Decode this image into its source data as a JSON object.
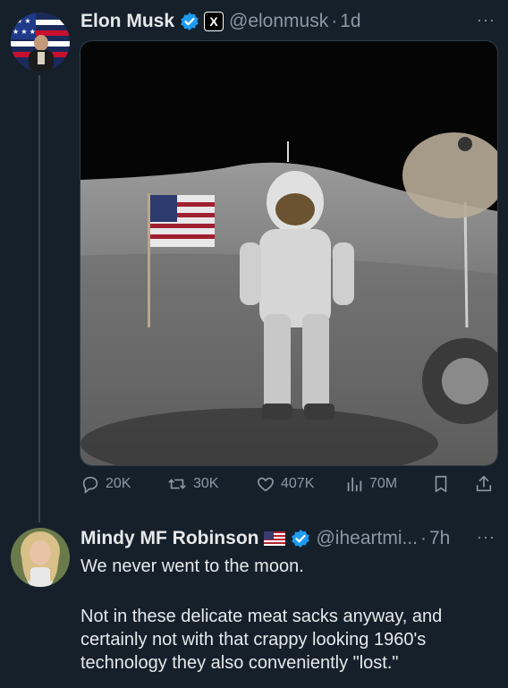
{
  "tweet": {
    "author_name": "Elon Musk",
    "handle": "@elonmusk",
    "separator": "·",
    "time": "1d",
    "x_badge": "X",
    "more": "···",
    "image_subject": "astronaut-on-moon-photo",
    "actions": {
      "reply_count": "20K",
      "repost_count": "30K",
      "like_count": "407K",
      "views_count": "70M"
    }
  },
  "reply": {
    "author_name": "Mindy MF Robinson",
    "handle": "@iheartmi...",
    "separator": "·",
    "time": "7h",
    "more": "···",
    "line1": "We never went to the moon.",
    "paragraph2": "Not in these delicate meat sacks anyway, and certainly not with that crappy looking 1960's technology they also conveniently \"lost.\""
  },
  "colors": {
    "background": "#15202b",
    "verified_blue": "#1d9bf0",
    "muted": "#8b98a5"
  }
}
